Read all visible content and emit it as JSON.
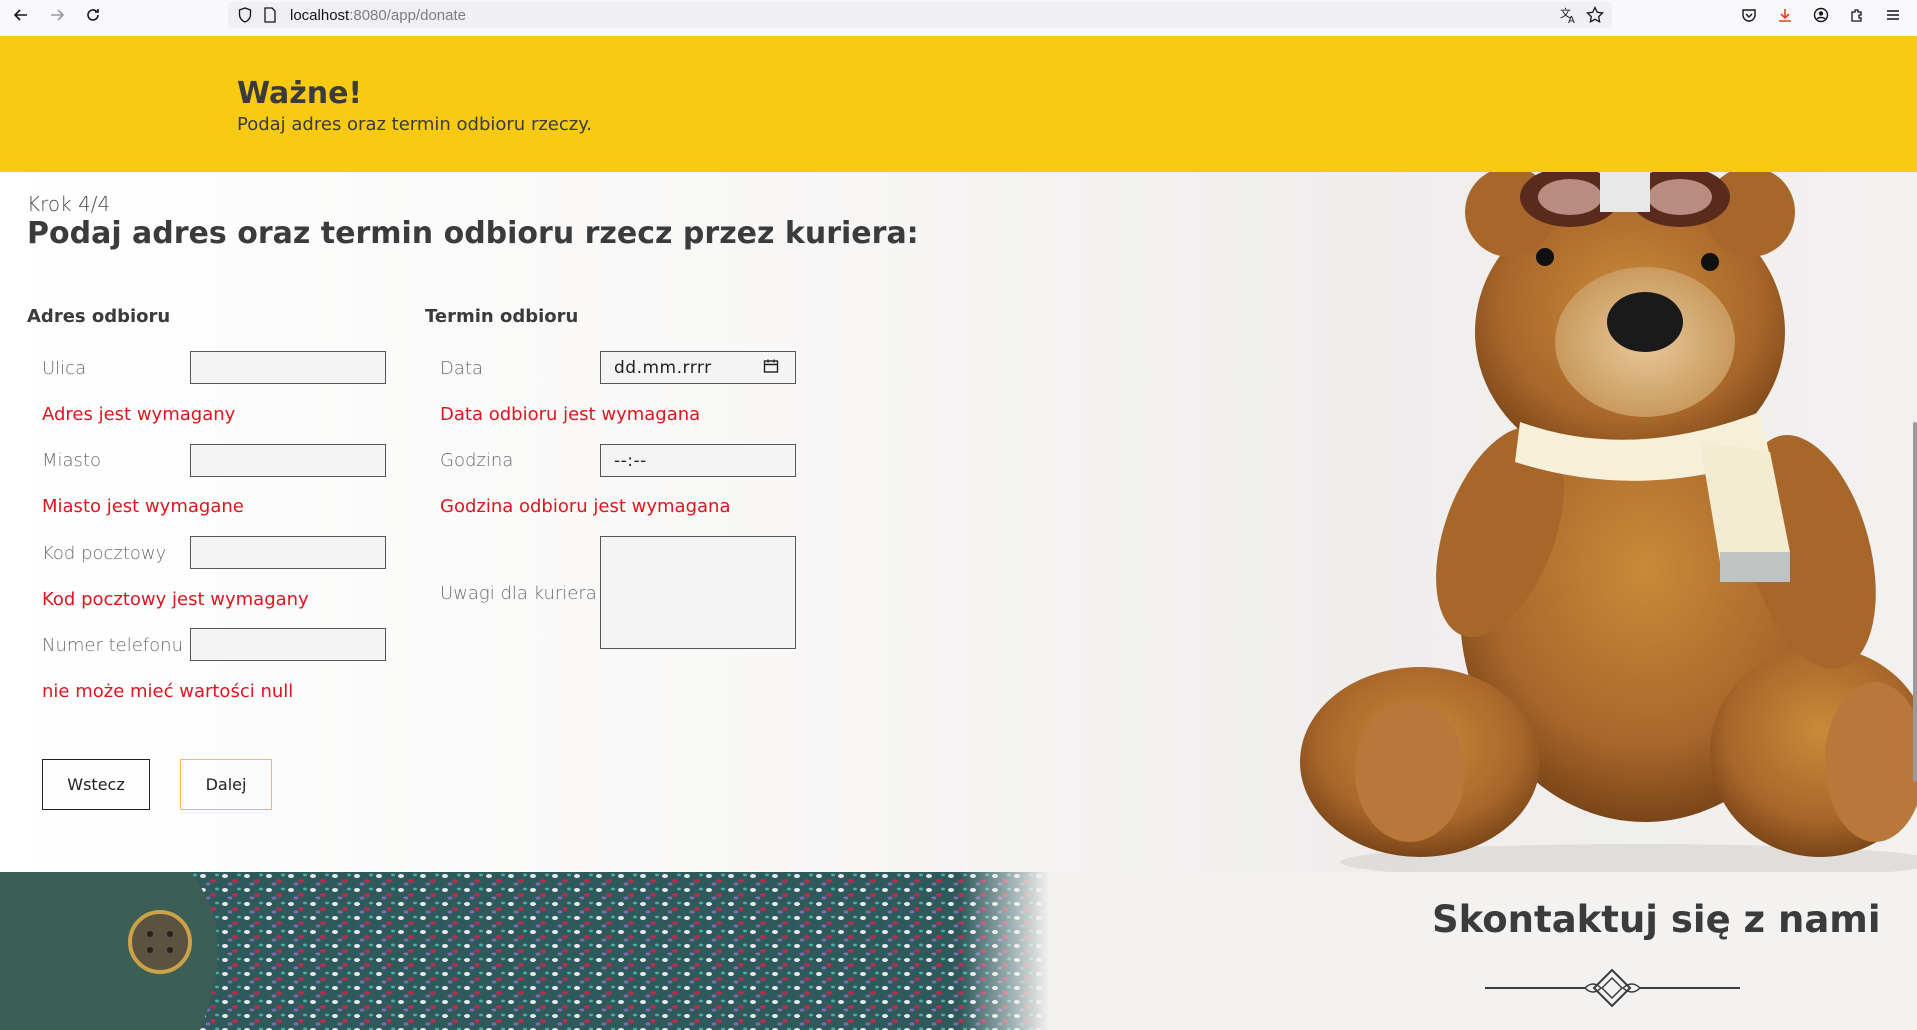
{
  "browser": {
    "url_host": "localhost",
    "url_path": ":8080/app/donate"
  },
  "notice": {
    "title": "Ważne!",
    "text": "Podaj adres oraz termin odbioru rzeczy."
  },
  "form": {
    "step": "Krok 4/4",
    "title": "Podaj adres oraz termin odbioru rzecz przez kuriera:",
    "address": {
      "title": "Adres odbioru",
      "street_label": "Ulica",
      "street_error": "Adres jest wymagany",
      "city_label": "Miasto",
      "city_error": "Miasto jest wymagane",
      "zip_label": "Kod pocztowy",
      "zip_error": "Kod pocztowy jest wymagany",
      "phone_label": "Numer telefonu",
      "phone_error": "nie może mieć wartości null"
    },
    "pickup": {
      "title": "Termin odbioru",
      "date_label": "Data",
      "date_placeholder": "dd.mm.rrrr",
      "date_error": "Data odbioru jest wymagana",
      "time_label": "Godzina",
      "time_placeholder": "--:--",
      "time_error": "Godzina odbioru jest wymagana",
      "notes_label": "Uwagi dla kuriera"
    },
    "back_label": "Wstecz",
    "next_label": "Dalej"
  },
  "contact": {
    "title": "Skontaktuj się z nami"
  },
  "colors": {
    "accent_yellow": "#f8ca12",
    "error_red": "#e0141e",
    "text_dark": "#3b3b3b"
  },
  "icons": [
    "back-arrow-icon",
    "forward-arrow-icon",
    "reload-icon",
    "shield-icon",
    "page-icon",
    "translate-icon",
    "star-icon",
    "pocket-icon",
    "download-icon",
    "account-icon",
    "extensions-icon",
    "menu-icon",
    "calendar-icon"
  ]
}
